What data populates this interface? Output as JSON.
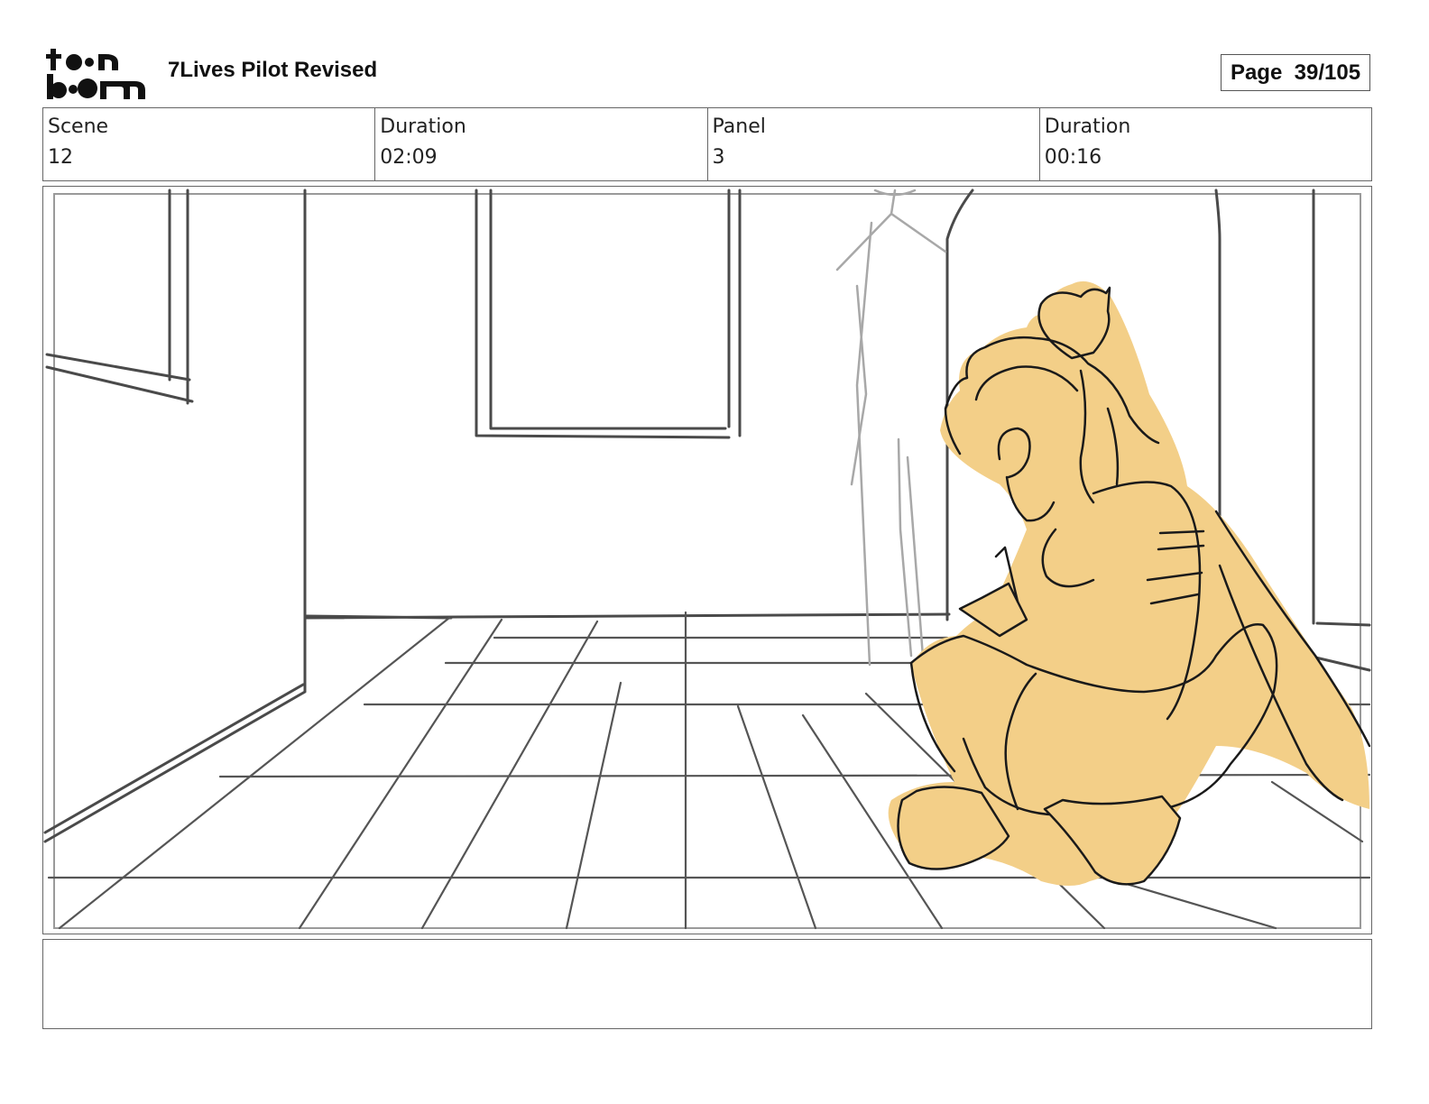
{
  "header": {
    "logo": {
      "text": "toon boom"
    },
    "project_title": "7Lives Pilot Revised",
    "page": "Page  39/105"
  },
  "info": {
    "scene_label": "Scene",
    "scene_value": "12",
    "scene_duration_label": "Duration",
    "scene_duration_value": "02:09",
    "panel_label": "Panel",
    "panel_value": "3",
    "panel_duration_label": "Duration",
    "panel_duration_value": "00:16"
  },
  "colors": {
    "line": "#3a3a3a",
    "ghost_line": "#a8a8a8",
    "character_fill": "#f3cf88"
  }
}
